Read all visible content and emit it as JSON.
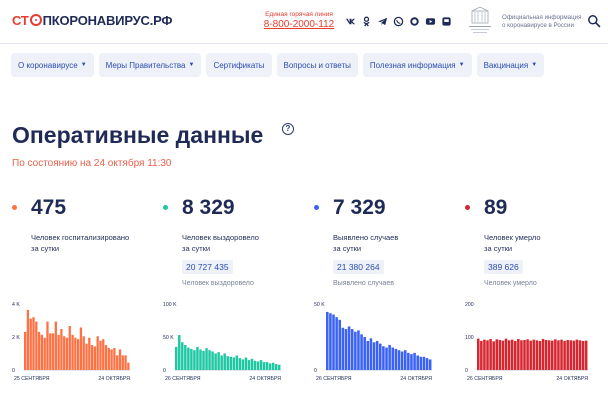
{
  "header": {
    "logo": {
      "part1": "СТ",
      "part2": "ПКОРОНАВИРУС.РФ"
    },
    "hotline_caption": "Единая горячая линия",
    "hotline_number": "8-800-2000-112",
    "socials": [
      "vk-icon",
      "ok-icon",
      "telegram-icon",
      "viber-icon",
      "whatsapp-icon",
      "youtube-icon",
      "app-icon"
    ],
    "official_line1": "Официальная информация",
    "official_line2": "о коронавирусе в России"
  },
  "nav": {
    "items": [
      {
        "label": "О коронавирусе",
        "dropdown": true
      },
      {
        "label": "Меры Правительства",
        "dropdown": true
      },
      {
        "label": "Сертификаты",
        "dropdown": false
      },
      {
        "label": "Вопросы и ответы",
        "dropdown": false
      },
      {
        "label": "Полезная информация",
        "dropdown": true
      },
      {
        "label": "Вакцинация",
        "dropdown": true
      }
    ]
  },
  "page": {
    "title": "Оперативные данные",
    "subtitle": "По состоянию на 24 октября 11:30"
  },
  "stats": [
    {
      "value": "475",
      "label_l1": "Человек госпитализировано",
      "label_l2": "за сутки",
      "total": "",
      "total_label": "",
      "color": "#ff7043"
    },
    {
      "value": "8 329",
      "label_l1": "Человек выздоровело",
      "label_l2": "за сутки",
      "total": "20 727 435",
      "total_label": "Человек выздоровело",
      "color": "#1fc7a3"
    },
    {
      "value": "7 329",
      "label_l1": "Выявлено случаев",
      "label_l2": "за сутки",
      "total": "21 380 264",
      "total_label": "Выявлено случаев",
      "color": "#3b62f5"
    },
    {
      "value": "89",
      "label_l1": "Человек умерло",
      "label_l2": "за сутки",
      "total": "389 626",
      "total_label": "Человек умерло",
      "color": "#d62630"
    }
  ],
  "chart_data": [
    {
      "type": "bar",
      "series_color": "#ff7043",
      "x_start_label": "25 СЕНТЯБРЯ",
      "x_end_label": "24 ОКТЯБРЯ",
      "y_ticks": [
        "4 K",
        "2 K",
        "0"
      ],
      "ylim": [
        0,
        4500
      ],
      "values": [
        2600,
        4100,
        3500,
        3600,
        3300,
        2600,
        2400,
        2200,
        3300,
        2500,
        2500,
        3300,
        2400,
        2800,
        2300,
        2200,
        3000,
        2400,
        2200,
        2100,
        2900,
        2300,
        1800,
        2200,
        1700,
        1600,
        2300,
        2000,
        2100,
        1700,
        1500,
        1400,
        1500,
        1000,
        1400,
        1000,
        1000,
        500
      ]
    },
    {
      "type": "bar",
      "series_color": "#1fc7a3",
      "x_start_label": "26 СЕНТЯБРЯ",
      "x_end_label": "24 ОКТЯБРЯ",
      "y_ticks": [
        "100 K",
        "50 K",
        "0"
      ],
      "ylim": [
        0,
        100000
      ],
      "values": [
        35000,
        53000,
        42000,
        38000,
        34000,
        32000,
        30000,
        35000,
        31000,
        29000,
        33000,
        30000,
        28000,
        25000,
        27000,
        22000,
        25000,
        21000,
        20000,
        19000,
        22000,
        18000,
        16000,
        19000,
        15000,
        17000,
        14000,
        13000,
        15000,
        12000,
        12000,
        10000,
        11000,
        9000,
        8000
      ]
    },
    {
      "type": "bar",
      "series_color": "#3b62f5",
      "x_start_label": "26 СЕНТЯБРЯ",
      "x_end_label": "24 ОКТЯБРЯ",
      "y_ticks": [
        "50 K",
        "0"
      ],
      "ylim": [
        0,
        50000
      ],
      "values": [
        44000,
        43000,
        42000,
        40000,
        38000,
        32000,
        31000,
        33000,
        31000,
        29000,
        30000,
        27000,
        25000,
        22000,
        24000,
        21000,
        22000,
        20000,
        18000,
        17000,
        19000,
        17000,
        16000,
        15000,
        14000,
        15000,
        13000,
        12000,
        13000,
        11000,
        10000,
        10000,
        9000,
        8000
      ]
    },
    {
      "type": "bar",
      "series_color": "#d62630",
      "x_start_label": "26 СЕНТЯБРЯ",
      "x_end_label": "24 ОКТЯБРЯ",
      "y_ticks": [
        "200",
        "100",
        "0"
      ],
      "ylim": [
        0,
        200
      ],
      "values": [
        95,
        88,
        92,
        90,
        94,
        87,
        93,
        91,
        89,
        95,
        90,
        92,
        88,
        94,
        90,
        91,
        93,
        89,
        92,
        90,
        88,
        94,
        91,
        90,
        89,
        93,
        90,
        92,
        88,
        91,
        90,
        89,
        92,
        90,
        88,
        89
      ]
    }
  ]
}
